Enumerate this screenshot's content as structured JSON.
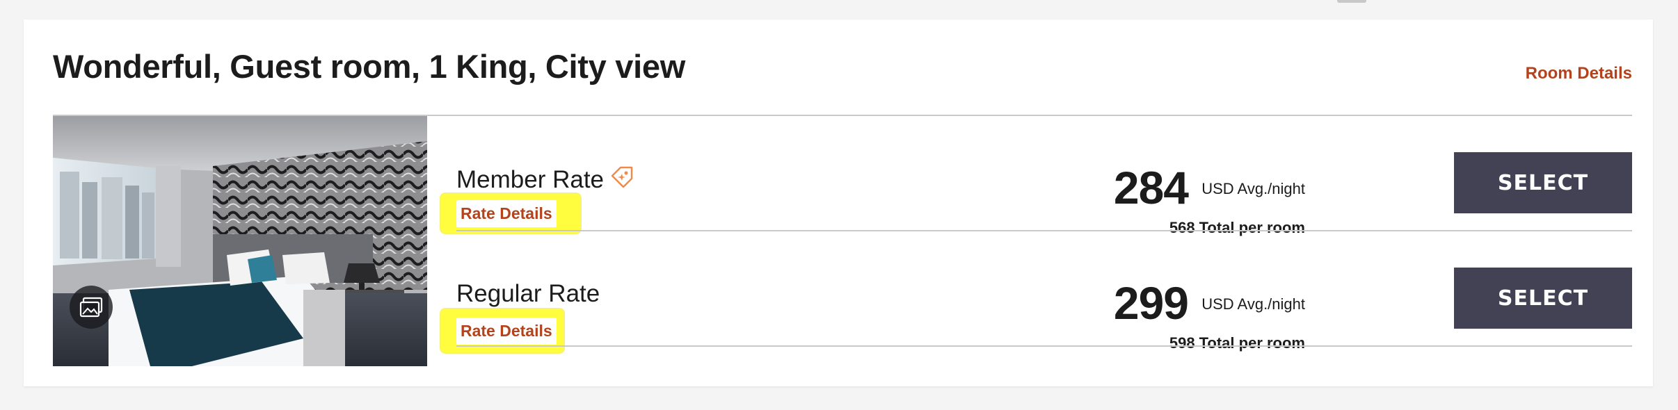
{
  "room": {
    "title": "Wonderful, Guest room, 1 King, City view",
    "details_link": "Room Details"
  },
  "rates": [
    {
      "name": "Member Rate",
      "details_link": "Rate Details",
      "price": "284",
      "unit": "USD Avg./night",
      "total_amount": "568",
      "total_label": "Total per room",
      "select_label": "SELECT",
      "has_member_tag": true
    },
    {
      "name": "Regular Rate",
      "details_link": "Rate Details",
      "price": "299",
      "unit": "USD Avg./night",
      "total_amount": "598",
      "total_label": "Total per room",
      "select_label": "SELECT",
      "has_member_tag": false
    }
  ],
  "icons": {
    "member_tag": "tag-icon",
    "gallery": "image-gallery-icon"
  },
  "colors": {
    "link": "#b3431d",
    "button": "#434154",
    "highlight": "#fffd3d",
    "tag": "#f08a4b"
  }
}
